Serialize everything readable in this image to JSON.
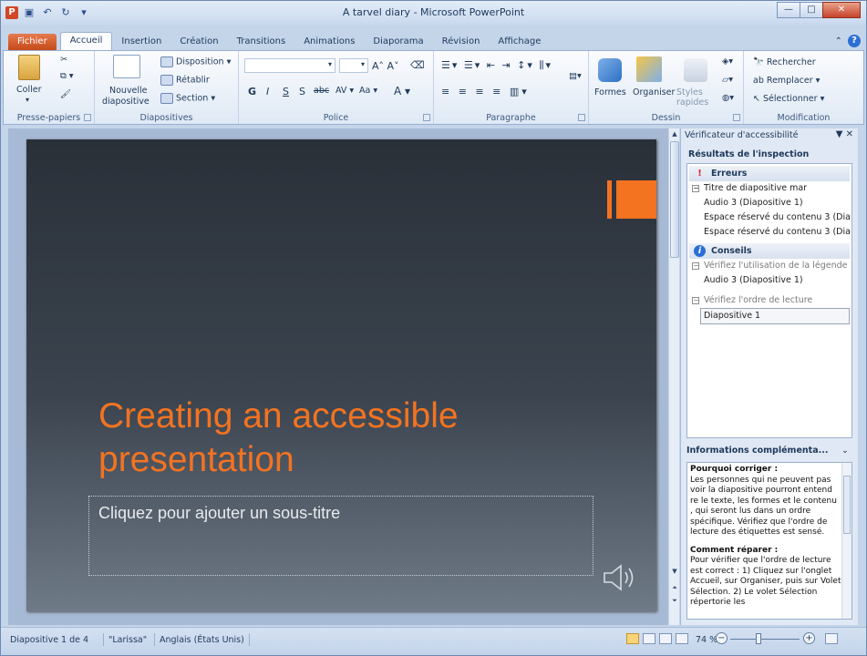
{
  "window": {
    "title": "A tarvel diary - Microsoft PowerPoint",
    "app_icon_letter": "P",
    "qat": [
      "save",
      "undo",
      "redo",
      "customize"
    ],
    "controls": [
      "—",
      "□",
      "✕"
    ]
  },
  "tabs": {
    "file": "Fichier",
    "items": [
      "Accueil",
      "Insertion",
      "Création",
      "Transitions",
      "Animations",
      "Diaporama",
      "Révision",
      "Affichage"
    ],
    "active": "Accueil"
  },
  "ribbon": {
    "clipboard": {
      "label": "Presse-papiers",
      "paste": "Coller"
    },
    "slides": {
      "label": "Diapositives",
      "new_slide_1": "Nouvelle",
      "new_slide_2": "diapositive",
      "layout": "Disposition",
      "reset": "Rétablir",
      "section": "Section"
    },
    "font": {
      "label": "Police",
      "bold": "G",
      "italic": "I",
      "underline": "S",
      "shadow": "S",
      "strike": "abc",
      "spacing": "AV",
      "case": "Aa"
    },
    "paragraph": {
      "label": "Paragraphe"
    },
    "drawing": {
      "label": "Dessin",
      "shapes": "Formes",
      "arrange": "Organiser",
      "quick_styles_1": "Styles",
      "quick_styles_2": "rapides"
    },
    "editing": {
      "label": "Modification",
      "find": "Rechercher",
      "replace": "Remplacer",
      "select": "Sélectionner"
    }
  },
  "slide": {
    "title": "Creating an accessible presentation",
    "subtitle_placeholder": "Cliquez pour ajouter un sous-titre"
  },
  "pane": {
    "title": "Vérificateur d'accessibilité",
    "results_label": "Résultats de l'inspection",
    "errors": {
      "label": "Erreurs",
      "groups": [
        {
          "title": "Titre de diapositive mar",
          "items": [
            "Audio 3  (Diapositive 1)",
            "Espace réservé du contenu  3 (Dia",
            "Espace réservé du contenu  3 (Dia"
          ]
        }
      ]
    },
    "tips": {
      "label": "Conseils",
      "groups": [
        {
          "title": "Vérifiez l'utilisation de la légende",
          "items": [
            "Audio 3  (Diapositive 1)"
          ]
        },
        {
          "title": "Vérifiez l'ordre de lecture",
          "items": [
            "Diapositive 1"
          ]
        }
      ]
    },
    "more_info": {
      "header": "Informations complémenta...",
      "why_title": "Pourquoi corriger :",
      "why_text": "Les personnes qui ne peuvent pas voir la diapositive pourront entend re le texte, les formes et le contenu , qui seront lus dans un ordre spécifique. Vérifiez que l'ordre de lecture des étiquettes est sensé.",
      "how_title": "Comment réparer :",
      "how_text": "Pour vérifier que l'ordre de lecture est correct : 1) Cliquez sur l'onglet Accueil, sur Organiser, puis sur Volet Sélection. 2) Le volet Sélection répertorie les"
    }
  },
  "status": {
    "slide_info": "Diapositive 1 de 4",
    "theme": "\"Larissa\"",
    "language": "Anglais (États Unis)",
    "zoom": "74 %"
  }
}
